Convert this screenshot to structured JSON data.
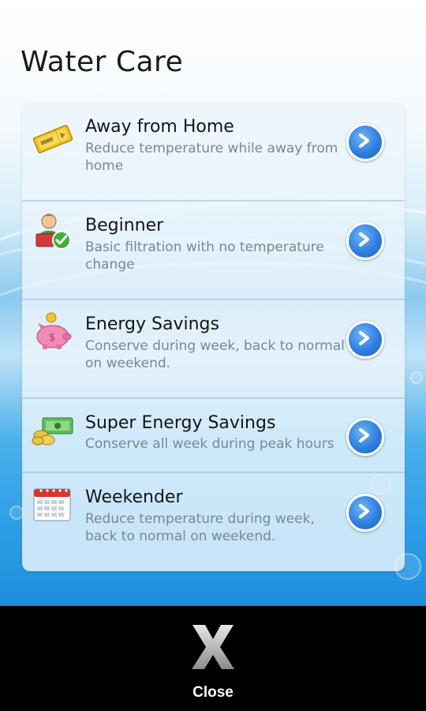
{
  "page": {
    "title": "Water Care"
  },
  "modes": [
    {
      "icon": "ticket-icon",
      "title": "Away from Home",
      "description": "Reduce temperature while away from home"
    },
    {
      "icon": "person-check-icon",
      "title": "Beginner",
      "description": "Basic filtration with no temperature change"
    },
    {
      "icon": "piggy-bank-icon",
      "title": "Energy Savings",
      "description": "Conserve during week, back to normal on weekend."
    },
    {
      "icon": "money-coins-icon",
      "title": "Super Energy Savings",
      "description": "Conserve all week during peak hours"
    },
    {
      "icon": "calendar-icon",
      "title": "Weekender",
      "description": "Reduce temperature during week, back to normal on weekend."
    }
  ],
  "bottom_bar": {
    "close_label": "Close",
    "close_icon": "x-icon"
  },
  "colors": {
    "button_blue": "#2f7fe0",
    "title_text": "#151515",
    "description_text": "#7b8792",
    "bottom_bar": "#000000"
  }
}
